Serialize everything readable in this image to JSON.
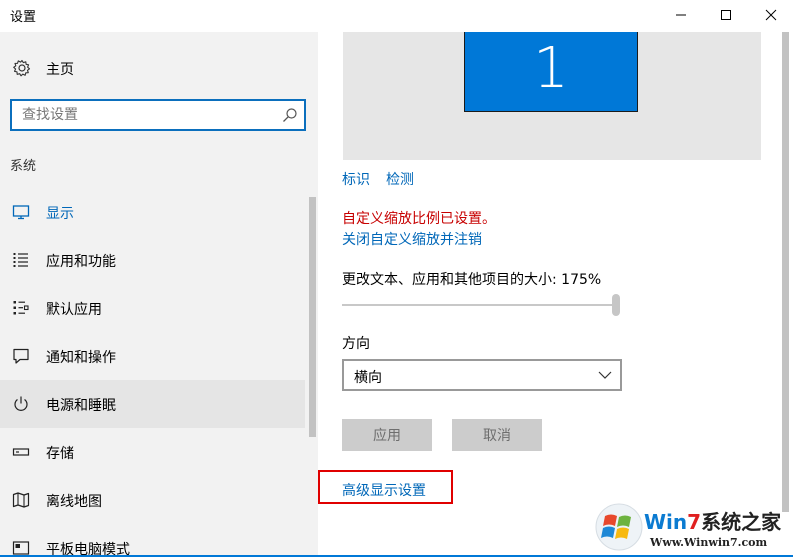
{
  "window": {
    "title": "设置",
    "controls": {
      "minimize": "minimize-icon",
      "maximize": "maximize-icon",
      "close": "close-icon"
    }
  },
  "sidebar": {
    "home": {
      "label": "主页",
      "icon": "gear-icon"
    },
    "search": {
      "placeholder": "查找设置",
      "icon": "search-icon"
    },
    "section_title": "系统",
    "items": [
      {
        "label": "显示",
        "icon": "monitor-icon",
        "state": "selected"
      },
      {
        "label": "应用和功能",
        "icon": "list-icon"
      },
      {
        "label": "默认应用",
        "icon": "default-apps-icon"
      },
      {
        "label": "通知和操作",
        "icon": "notification-icon"
      },
      {
        "label": "电源和睡眠",
        "icon": "power-icon",
        "state": "hover"
      },
      {
        "label": "存储",
        "icon": "storage-icon"
      },
      {
        "label": "离线地图",
        "icon": "map-icon"
      },
      {
        "label": "平板电脑模式",
        "icon": "tablet-icon"
      }
    ]
  },
  "display": {
    "monitor_number": "1",
    "identify": "标识",
    "detect": "检测",
    "warning": "自定义缩放比例已设置。",
    "signout_link": "关闭自定义缩放并注销",
    "size_label": "更改文本、应用和其他项目的大小: 175%",
    "scale_fraction": 1.0,
    "orientation_label": "方向",
    "orientation_value": "横向",
    "apply": "应用",
    "cancel": "取消",
    "advanced_link": "高级显示设置"
  },
  "watermark": {
    "brand_win": "Win",
    "brand_7": "7",
    "brand_rest": "系统之家",
    "url": "Www.Winwin7.com"
  },
  "colors": {
    "accent": "#0067b8",
    "warning": "#c70000",
    "highlight_box": "#e00000",
    "monitor": "#0078d7"
  }
}
